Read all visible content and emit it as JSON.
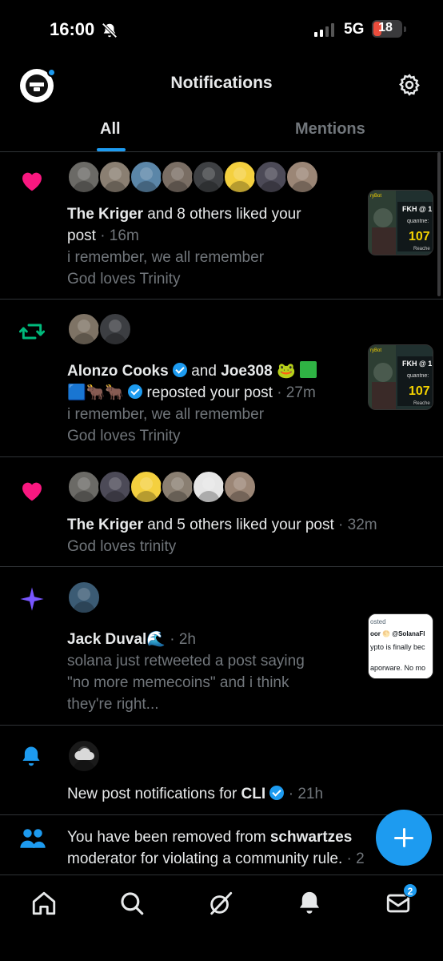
{
  "status_bar": {
    "time": "16:00",
    "network": "5G",
    "battery": "18"
  },
  "header": {
    "title": "Notifications"
  },
  "tabs": [
    {
      "label": "All",
      "active": true
    },
    {
      "label": "Mentions",
      "active": false
    }
  ],
  "notifications": [
    {
      "type": "like",
      "actor": "The Kriger",
      "action": " and 8 others liked your",
      "action2": "post",
      "time": "· 16m",
      "line1": "i remember, we all remember",
      "line2": "God loves Trinity",
      "avatar_colors": [
        "#6b6a66",
        "#8a7f72",
        "#5b86a8",
        "#7a6e64",
        "#3e4043",
        "#f4d03f",
        "#4c4a57",
        "#9b8676"
      ]
    },
    {
      "type": "repost",
      "actor": "Alonzo Cooks",
      "and": "and",
      "actor2": "Joe308",
      "emoji_line": "🟦🐂🐂",
      "action": "reposted your post",
      "time": "· 27m",
      "line1": "i remember, we all remember",
      "line2": "God loves Trinity",
      "avatar_colors": [
        "#7e7365",
        "#3c3e42"
      ]
    },
    {
      "type": "like",
      "actor": "The Kriger",
      "action": " and 5 others liked your post",
      "time": "· 32m",
      "line1": "God loves trinity",
      "avatar_colors": [
        "#6b6a66",
        "#4c4a57",
        "#f4d03f",
        "#8a7f72",
        "#e6e6e6",
        "#9b8676"
      ]
    },
    {
      "type": "recommendation",
      "actor": "Jack Duval🌊",
      "time": "· 2h",
      "line1": "solana just retweeted a post saying",
      "line2": "\"no more memecoins\" and i think",
      "line3": "they're right...",
      "avatar_colors": [
        "#3b5b74"
      ]
    },
    {
      "type": "post-alert",
      "prefix": "New post notifications for ",
      "account": "CLI",
      "time": "· 21h"
    },
    {
      "type": "community",
      "prefix": "You have been removed from ",
      "community": "schwartzes",
      "line2": "moderator for violating a community rule.",
      "time": "· 2"
    }
  ],
  "thumb_text": {
    "t1": "FKH @ 1",
    "t2": "quantne:",
    "t3": "107",
    "t4": "Reache",
    "t5": "ryBot",
    "s1": "osted",
    "s2": "oor 🌕 @SolanaFl",
    "s3": "ypto is finally bec",
    "s4": "aporware. No mo"
  },
  "bottom_nav": {
    "messages_badge": "2"
  },
  "colors": {
    "accent": "#1d9bf0",
    "like": "#f91880",
    "repost": "#00ba7c",
    "star": "#7856ff"
  }
}
